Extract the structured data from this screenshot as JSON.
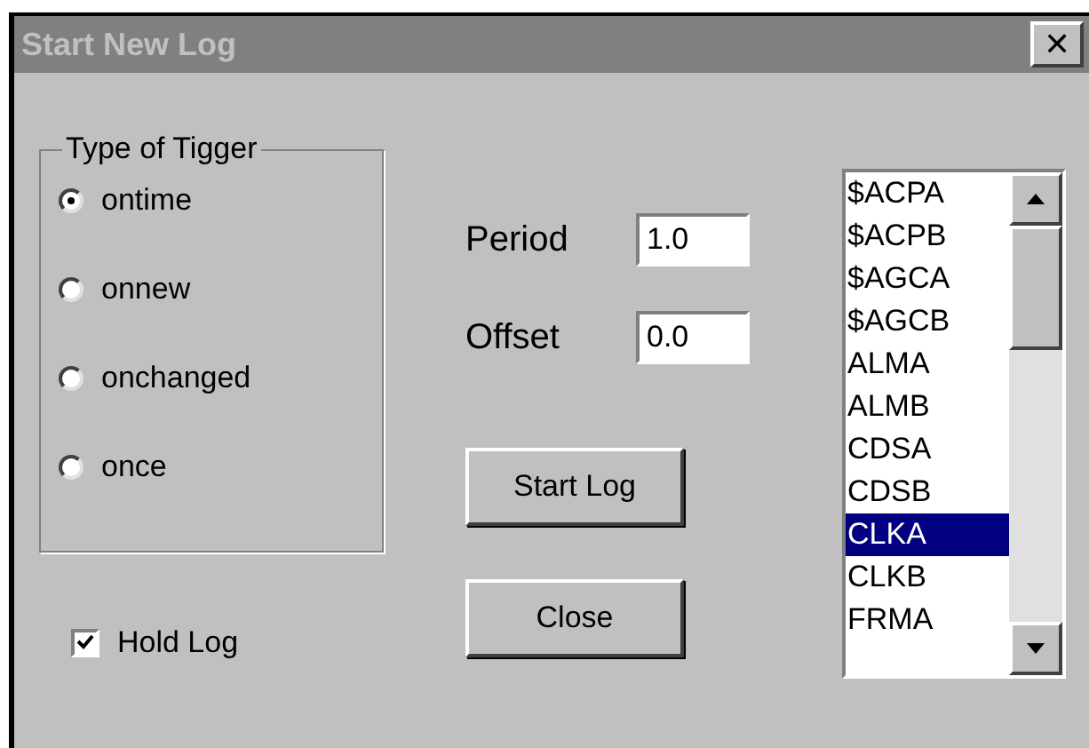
{
  "window": {
    "title": "Start New Log",
    "close": "✕"
  },
  "trigger_group": {
    "title": "Type of Tigger",
    "options": [
      {
        "label": "ontime",
        "selected": true
      },
      {
        "label": "onnew",
        "selected": false
      },
      {
        "label": "onchanged",
        "selected": false
      },
      {
        "label": "once",
        "selected": false
      }
    ]
  },
  "hold_log": {
    "label": "Hold Log",
    "checked": true
  },
  "period": {
    "label": "Period",
    "value": "1.0"
  },
  "offset": {
    "label": "Offset",
    "value": "0.0"
  },
  "buttons": [
    "Start Log",
    "Close"
  ],
  "list": {
    "items": [
      {
        "label": "$ACPA",
        "selected": false
      },
      {
        "label": "$ACPB",
        "selected": false
      },
      {
        "label": "$AGCA",
        "selected": false
      },
      {
        "label": "$AGCB",
        "selected": false
      },
      {
        "label": "ALMA",
        "selected": false
      },
      {
        "label": "ALMB",
        "selected": false
      },
      {
        "label": "CDSA",
        "selected": false
      },
      {
        "label": "CDSB",
        "selected": false
      },
      {
        "label": "CLKA",
        "selected": true
      },
      {
        "label": "CLKB",
        "selected": false
      },
      {
        "label": "FRMA",
        "selected": false
      }
    ]
  }
}
